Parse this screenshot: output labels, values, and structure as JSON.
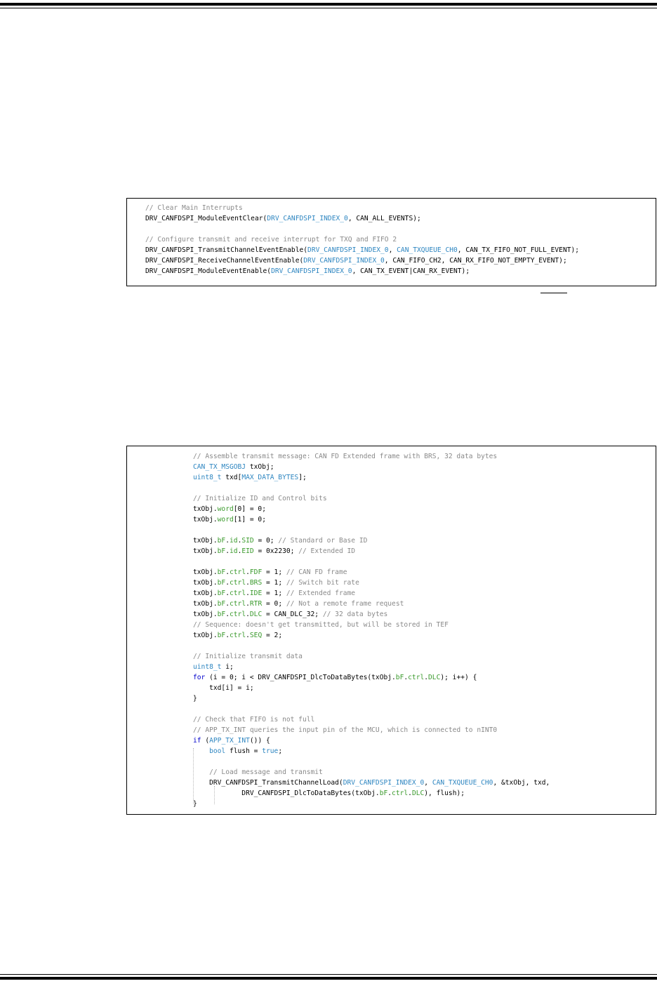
{
  "code_block_1": {
    "lines": [
      [
        {
          "t": "// Clear Main Interrupts",
          "c": "c"
        }
      ],
      [
        {
          "t": "DRV_CANFDSPI_ModuleEventClear(",
          "c": ""
        },
        {
          "t": "DRV_CANFDSPI_INDEX_0",
          "c": "b"
        },
        {
          "t": ", CAN_ALL_EVENTS);",
          "c": ""
        }
      ],
      [],
      [
        {
          "t": "// Configure transmit and receive interrupt for TXQ and FIFO 2",
          "c": "c"
        }
      ],
      [
        {
          "t": "DRV_CANFDSPI_TransmitChannelEventEnable(",
          "c": ""
        },
        {
          "t": "DRV_CANFDSPI_INDEX_0",
          "c": "b"
        },
        {
          "t": ", ",
          "c": ""
        },
        {
          "t": "CAN_TXQUEUE_CH0",
          "c": "b"
        },
        {
          "t": ", CAN_TX_FIFO_NOT_FULL_EVENT);",
          "c": ""
        }
      ],
      [
        {
          "t": "DRV_CANFDSPI_ReceiveChannelEventEnable(",
          "c": ""
        },
        {
          "t": "DRV_CANFDSPI_INDEX_0",
          "c": "b"
        },
        {
          "t": ", CAN_FIFO_CH2, CAN_RX_FIFO_NOT_EMPTY_EVENT);",
          "c": ""
        }
      ],
      [
        {
          "t": "DRV_CANFDSPI_ModuleEventEnable(",
          "c": ""
        },
        {
          "t": "DRV_CANFDSPI_INDEX_0",
          "c": "b"
        },
        {
          "t": ", CAN_TX_EVENT|CAN_RX_EVENT);",
          "c": ""
        }
      ]
    ]
  },
  "code_block_2": {
    "lines": [
      [
        {
          "t": "// Assemble transmit message: CAN FD Extended frame with BRS, 32 data bytes",
          "c": "c"
        }
      ],
      [
        {
          "t": "CAN_TX_MSGOBJ",
          "c": "b"
        },
        {
          "t": " txObj;",
          "c": ""
        }
      ],
      [
        {
          "t": "uint8_t",
          "c": "b"
        },
        {
          "t": " txd[",
          "c": ""
        },
        {
          "t": "MAX_DATA_BYTES",
          "c": "b"
        },
        {
          "t": "];",
          "c": ""
        }
      ],
      [],
      [
        {
          "t": "// Initialize ID and Control bits",
          "c": "c"
        }
      ],
      [
        {
          "t": "txObj.",
          "c": ""
        },
        {
          "t": "word",
          "c": "g"
        },
        {
          "t": "[0] = 0;",
          "c": ""
        }
      ],
      [
        {
          "t": "txObj.",
          "c": ""
        },
        {
          "t": "word",
          "c": "g"
        },
        {
          "t": "[1] = 0;",
          "c": ""
        }
      ],
      [],
      [
        {
          "t": "txObj.",
          "c": ""
        },
        {
          "t": "bF",
          "c": "g"
        },
        {
          "t": ".",
          "c": ""
        },
        {
          "t": "id",
          "c": "g"
        },
        {
          "t": ".",
          "c": ""
        },
        {
          "t": "SID",
          "c": "g"
        },
        {
          "t": " = 0; ",
          "c": ""
        },
        {
          "t": "// Standard or Base ID",
          "c": "c"
        }
      ],
      [
        {
          "t": "txObj.",
          "c": ""
        },
        {
          "t": "bF",
          "c": "g"
        },
        {
          "t": ".",
          "c": ""
        },
        {
          "t": "id",
          "c": "g"
        },
        {
          "t": ".",
          "c": ""
        },
        {
          "t": "EID",
          "c": "g"
        },
        {
          "t": " = 0x2230; ",
          "c": ""
        },
        {
          "t": "// Extended ID",
          "c": "c"
        }
      ],
      [],
      [
        {
          "t": "txObj.",
          "c": ""
        },
        {
          "t": "bF",
          "c": "g"
        },
        {
          "t": ".",
          "c": ""
        },
        {
          "t": "ctrl",
          "c": "g"
        },
        {
          "t": ".",
          "c": ""
        },
        {
          "t": "FDF",
          "c": "g"
        },
        {
          "t": " = 1; ",
          "c": ""
        },
        {
          "t": "// CAN FD frame",
          "c": "c"
        }
      ],
      [
        {
          "t": "txObj.",
          "c": ""
        },
        {
          "t": "bF",
          "c": "g"
        },
        {
          "t": ".",
          "c": ""
        },
        {
          "t": "ctrl",
          "c": "g"
        },
        {
          "t": ".",
          "c": ""
        },
        {
          "t": "BRS",
          "c": "g"
        },
        {
          "t": " = 1; ",
          "c": ""
        },
        {
          "t": "// Switch bit rate",
          "c": "c"
        }
      ],
      [
        {
          "t": "txObj.",
          "c": ""
        },
        {
          "t": "bF",
          "c": "g"
        },
        {
          "t": ".",
          "c": ""
        },
        {
          "t": "ctrl",
          "c": "g"
        },
        {
          "t": ".",
          "c": ""
        },
        {
          "t": "IDE",
          "c": "g"
        },
        {
          "t": " = 1; ",
          "c": ""
        },
        {
          "t": "// Extended frame",
          "c": "c"
        }
      ],
      [
        {
          "t": "txObj.",
          "c": ""
        },
        {
          "t": "bF",
          "c": "g"
        },
        {
          "t": ".",
          "c": ""
        },
        {
          "t": "ctrl",
          "c": "g"
        },
        {
          "t": ".",
          "c": ""
        },
        {
          "t": "RTR",
          "c": "g"
        },
        {
          "t": " = 0; ",
          "c": ""
        },
        {
          "t": "// Not a remote frame request",
          "c": "c"
        }
      ],
      [
        {
          "t": "txObj.",
          "c": ""
        },
        {
          "t": "bF",
          "c": "g"
        },
        {
          "t": ".",
          "c": ""
        },
        {
          "t": "ctrl",
          "c": "g"
        },
        {
          "t": ".",
          "c": ""
        },
        {
          "t": "DLC",
          "c": "g"
        },
        {
          "t": " = CAN_DLC_32; ",
          "c": ""
        },
        {
          "t": "// 32 data bytes",
          "c": "c"
        }
      ],
      [
        {
          "t": "// Sequence: doesn't get transmitted, but will be stored in TEF",
          "c": "c"
        }
      ],
      [
        {
          "t": "txObj.",
          "c": ""
        },
        {
          "t": "bF",
          "c": "g"
        },
        {
          "t": ".",
          "c": ""
        },
        {
          "t": "ctrl",
          "c": "g"
        },
        {
          "t": ".",
          "c": ""
        },
        {
          "t": "SEQ",
          "c": "g"
        },
        {
          "t": " = 2;",
          "c": ""
        }
      ],
      [],
      [
        {
          "t": "// Initialize transmit data",
          "c": "c"
        }
      ],
      [
        {
          "t": "uint8_t",
          "c": "b"
        },
        {
          "t": " i;",
          "c": ""
        }
      ],
      [
        {
          "t": "for",
          "c": "k"
        },
        {
          "t": " (i = 0; i < DRV_CANFDSPI_DlcToDataBytes(txObj.",
          "c": ""
        },
        {
          "t": "bF",
          "c": "g"
        },
        {
          "t": ".",
          "c": ""
        },
        {
          "t": "ctrl",
          "c": "g"
        },
        {
          "t": ".",
          "c": ""
        },
        {
          "t": "DLC",
          "c": "g"
        },
        {
          "t": "); i++) {",
          "c": ""
        }
      ],
      [
        {
          "t": "    txd[i] = i;",
          "c": ""
        }
      ],
      [
        {
          "t": "}",
          "c": ""
        }
      ],
      [],
      [
        {
          "t": "// Check that FIFO is not full",
          "c": "c"
        }
      ],
      [
        {
          "t": "// APP_TX_INT queries the input pin of the MCU, which is connected to nINT0",
          "c": "c"
        }
      ],
      [
        {
          "t": "if",
          "c": "k"
        },
        {
          "t": " (",
          "c": ""
        },
        {
          "t": "APP_TX_INT",
          "c": "b"
        },
        {
          "t": "()) {",
          "c": ""
        }
      ],
      [
        {
          "t": "    ",
          "c": ""
        },
        {
          "t": "bool",
          "c": "b"
        },
        {
          "t": " flush = ",
          "c": ""
        },
        {
          "t": "true",
          "c": "b"
        },
        {
          "t": ";",
          "c": ""
        }
      ],
      [],
      [
        {
          "t": "    ",
          "c": ""
        },
        {
          "t": "// Load message and transmit",
          "c": "c"
        }
      ],
      [
        {
          "t": "    DRV_CANFDSPI_TransmitChannelLoad(",
          "c": ""
        },
        {
          "t": "DRV_CANFDSPI_INDEX_0",
          "c": "b"
        },
        {
          "t": ", ",
          "c": ""
        },
        {
          "t": "CAN_TXQUEUE_CH0",
          "c": "b"
        },
        {
          "t": ", &txObj, txd,",
          "c": ""
        }
      ],
      [
        {
          "t": "            DRV_CANFDSPI_DlcToDataBytes(txObj.",
          "c": ""
        },
        {
          "t": "bF",
          "c": "g"
        },
        {
          "t": ".",
          "c": ""
        },
        {
          "t": "ctrl",
          "c": "g"
        },
        {
          "t": ".",
          "c": ""
        },
        {
          "t": "DLC",
          "c": "g"
        },
        {
          "t": "), flush);",
          "c": ""
        }
      ],
      [
        {
          "t": "}",
          "c": ""
        }
      ]
    ]
  }
}
